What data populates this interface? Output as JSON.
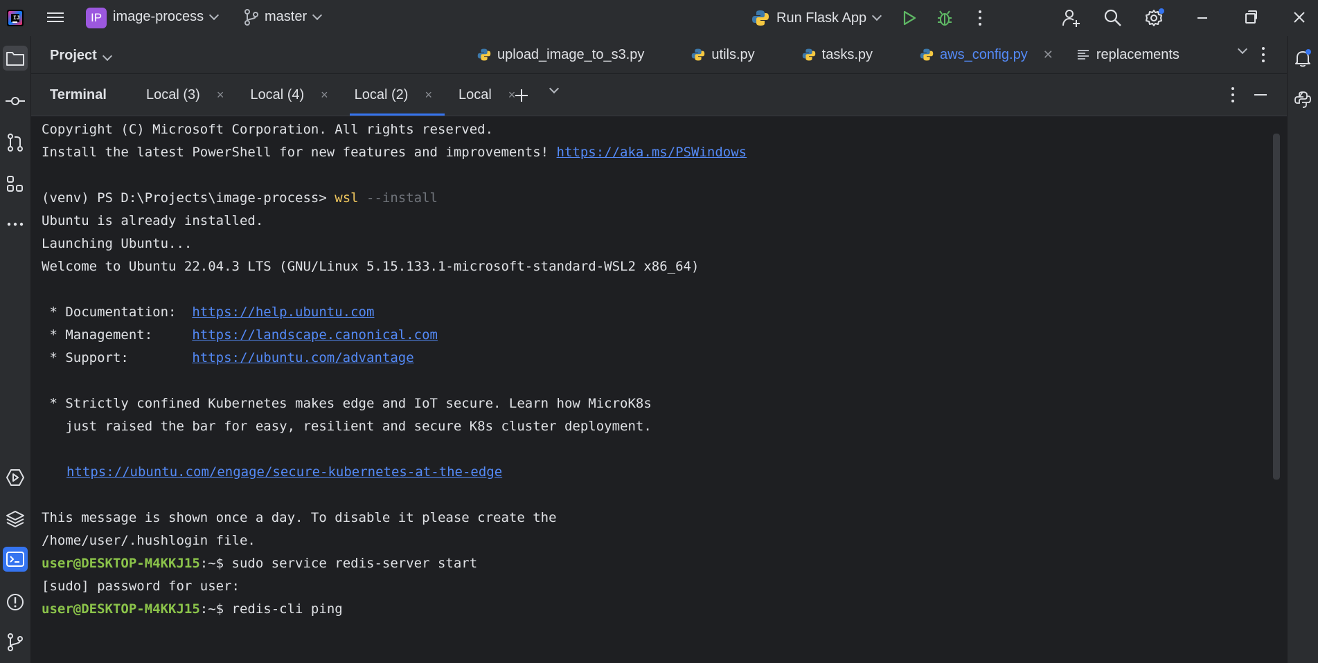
{
  "titlebar": {
    "logo_text": "IJ",
    "project_badge": "IP",
    "project_name": "image-process",
    "branch": "master",
    "run_config": "Run Flask App"
  },
  "editor": {
    "project_label": "Project",
    "tabs": [
      {
        "label": "upload_image_to_s3.py",
        "active": false
      },
      {
        "label": "utils.py",
        "active": false
      },
      {
        "label": "tasks.py",
        "active": false
      },
      {
        "label": "aws_config.py",
        "active": true
      },
      {
        "label": "replacements",
        "active": false
      }
    ]
  },
  "terminal": {
    "title": "Terminal",
    "tabs": [
      {
        "label": "Local (3)",
        "close": "×"
      },
      {
        "label": "Local (4)",
        "close": "×"
      },
      {
        "label": "Local (2)",
        "close": "×"
      },
      {
        "label": "Local",
        "close": "×"
      }
    ],
    "lines": {
      "l1": "Copyright (C) Microsoft Corporation. All rights reserved.",
      "l2_text": "Install the latest PowerShell for new features and improvements! ",
      "l2_link": "https://aka.ms/PSWindows",
      "l3_prompt": "(venv) PS D:\\Projects\\image-process> ",
      "l3_cmd": "wsl",
      "l3_arg": " --install",
      "l4": "Ubuntu is already installed.",
      "l5": "Launching Ubuntu...",
      "l6": "Welcome to Ubuntu 22.04.3 LTS (GNU/Linux 5.15.133.1-microsoft-standard-WSL2 x86_64)",
      "l7_label": " * Documentation:  ",
      "l7_link": "https://help.ubuntu.com",
      "l8_label": " * Management:     ",
      "l8_link": "https://landscape.canonical.com",
      "l9_label": " * Support:        ",
      "l9_link": "https://ubuntu.com/advantage",
      "l10": " * Strictly confined Kubernetes makes edge and IoT secure. Learn how MicroK8s",
      "l11": "   just raised the bar for easy, resilient and secure K8s cluster deployment.",
      "l12_link": "https://ubuntu.com/engage/secure-kubernetes-at-the-edge",
      "l13": "This message is shown once a day. To disable it please create the",
      "l14": "/home/user/.hushlogin file.",
      "l15_user": "user@DESKTOP-M4KKJ15",
      "l15_path": ":~$ ",
      "l15_cmd": "sudo service redis-server start",
      "l16": "[sudo] password for user:",
      "l17_user": "user@DESKTOP-M4KKJ15",
      "l17_path": ":~$ ",
      "l17_cmd": "redis-cli ping"
    }
  },
  "colors": {
    "accent": "#3574f0",
    "link": "#548af7",
    "prompt_user": "#8bc34a",
    "command": "#f0c75e"
  }
}
